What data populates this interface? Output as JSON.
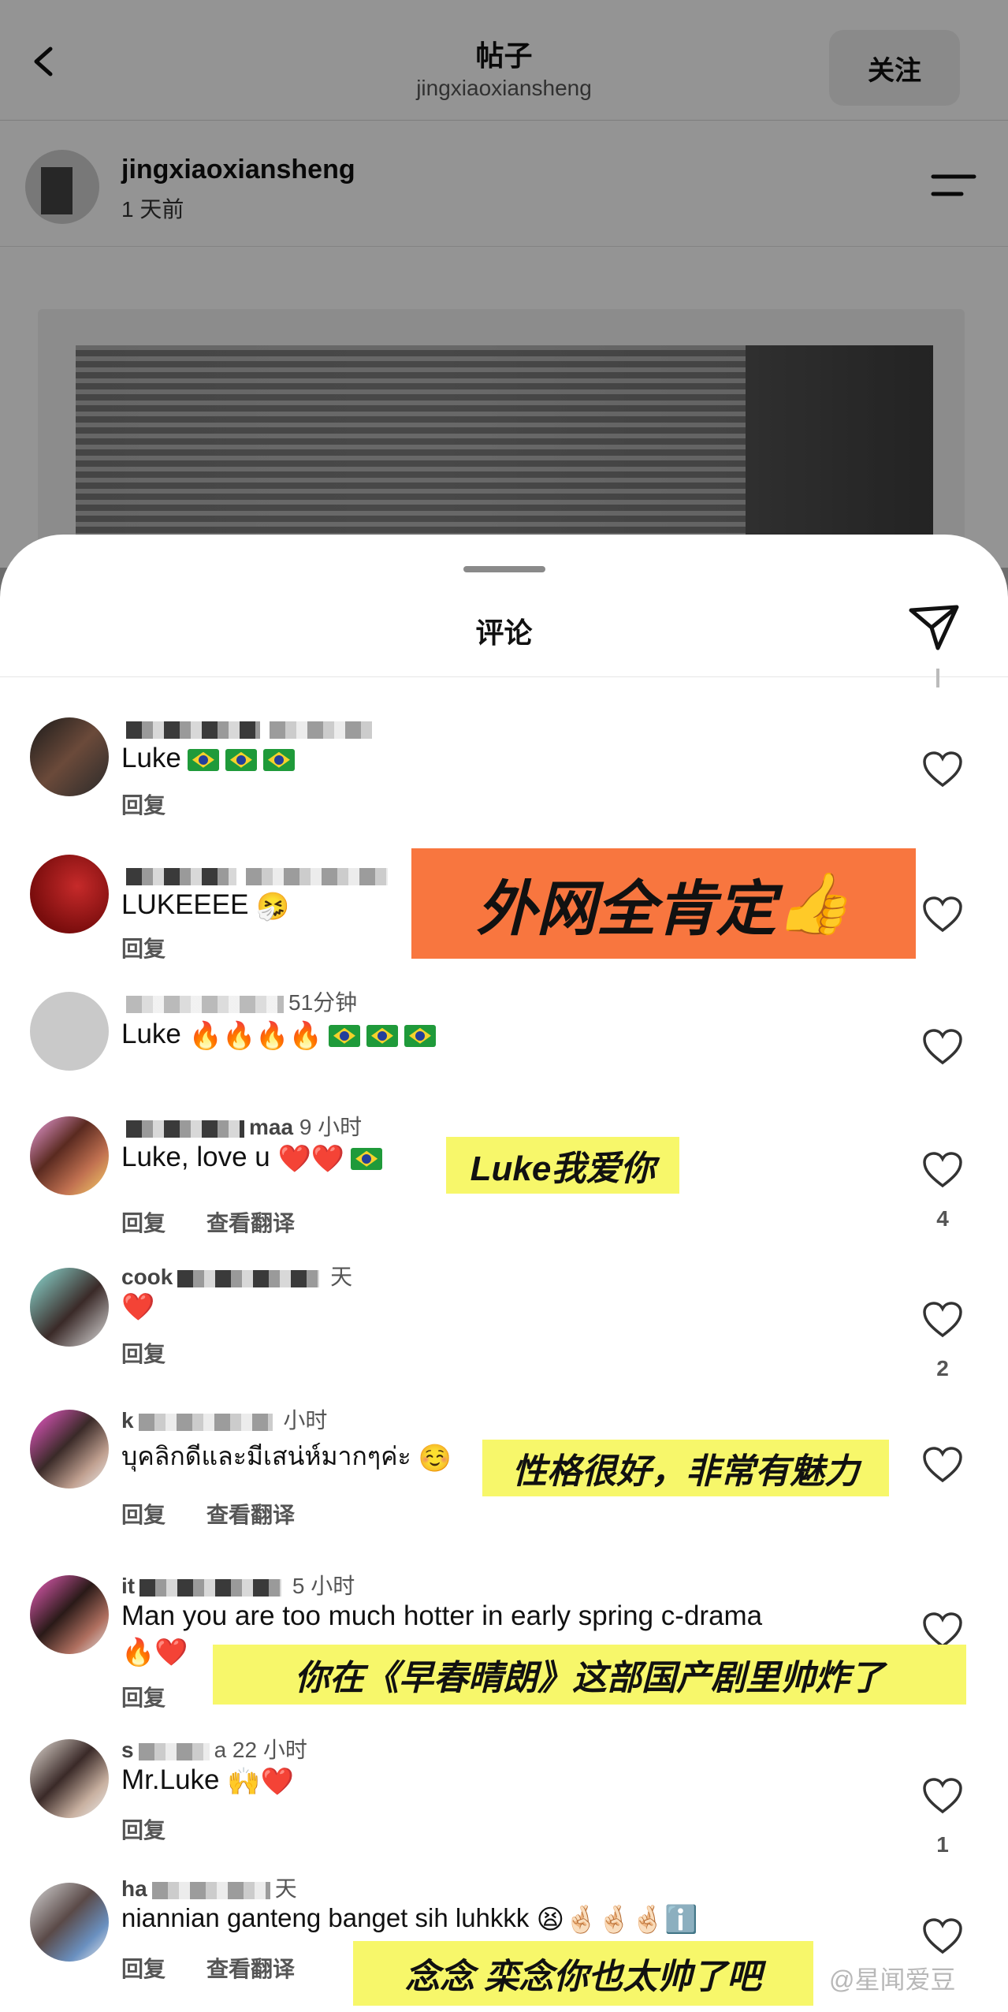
{
  "header": {
    "title": "帖子",
    "subtitle": "jingxiaoxiansheng",
    "follow_label": "关注"
  },
  "author": {
    "name": "jingxiaoxiansheng",
    "time": "1 天前"
  },
  "sheet": {
    "title": "评论"
  },
  "comments": [
    {
      "user_suffix": "",
      "meta": "",
      "text": "Luke",
      "reply": "回复",
      "translate": "",
      "likes": ""
    },
    {
      "user_suffix": "",
      "meta": "",
      "text": "LUKEEEE",
      "reply": "回复",
      "translate": "",
      "likes": ""
    },
    {
      "user_suffix": "",
      "meta": "51分钟",
      "text": "Luke",
      "reply": "",
      "translate": "",
      "likes": ""
    },
    {
      "user_suffix": "maa",
      "meta": "9 小时",
      "text": "Luke, love u",
      "reply": "回复",
      "translate": "查看翻译",
      "likes": "4"
    },
    {
      "user_suffix": "cook",
      "meta": "天",
      "text": "",
      "reply": "回复",
      "translate": "",
      "likes": "2"
    },
    {
      "user_suffix": "k",
      "meta": "小时",
      "text": "บุคลิกดีและมีเสน่ห์มากๆค่ะ",
      "reply": "回复",
      "translate": "查看翻译",
      "likes": ""
    },
    {
      "user_suffix": "it",
      "meta": "5 小时",
      "text": "Man you are too much hotter in early spring c-drama",
      "reply": "回复",
      "translate": "",
      "likes": ""
    },
    {
      "user_suffix": "s",
      "meta": "a 22 小时",
      "text": "Mr.Luke",
      "reply": "回复",
      "translate": "",
      "likes": "1"
    },
    {
      "user_suffix": "ha",
      "meta": "天",
      "text": "niannian ganteng banget sih luhkkk",
      "reply": "回复",
      "translate": "查看翻译",
      "likes": ""
    }
  ],
  "annotations": {
    "a1": "外网全肯定",
    "a2": "Luke我爱你",
    "a3": "性格很好，非常有魅力",
    "a4": "你在《早春晴朗》这部国产剧里帅炸了",
    "a5": "念念 栾念你也太帅了吧"
  },
  "watermark": "@星闻爱豆"
}
